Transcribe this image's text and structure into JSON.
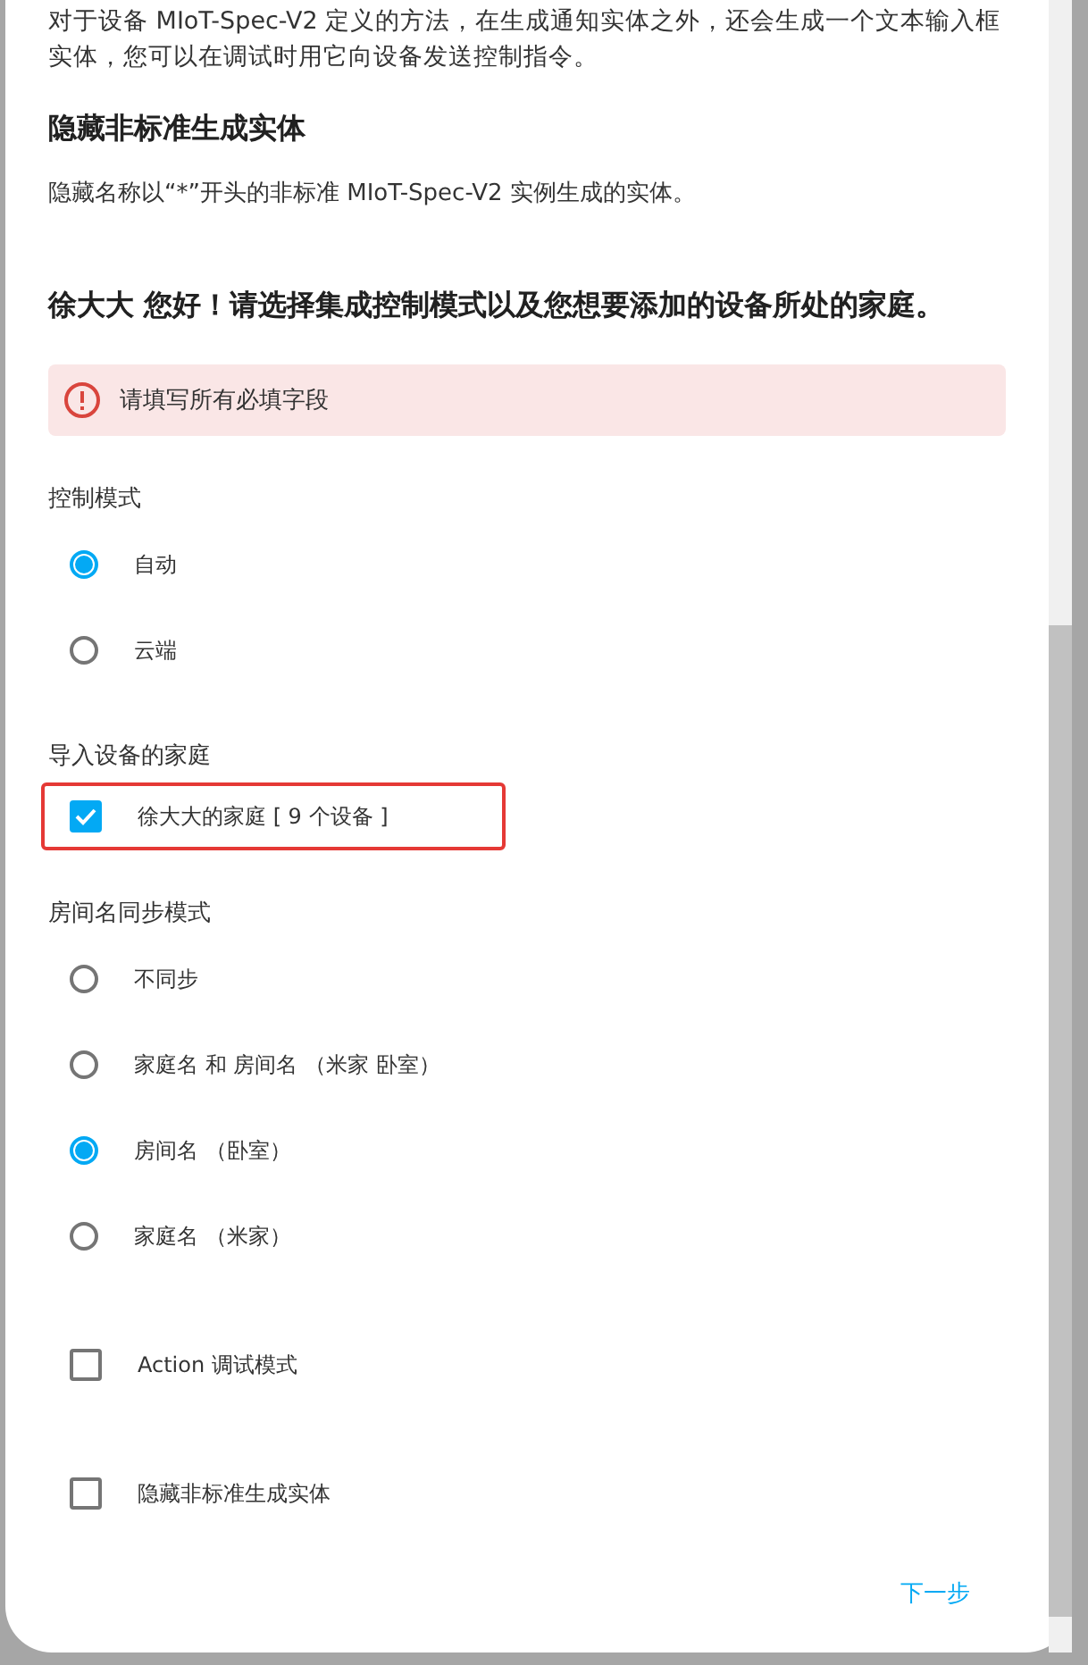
{
  "intro": {
    "text": "对于设备 MIoT-Spec-V2 定义的方法，在生成通知实体之外，还会生成一个文本输入框实体，您可以在调试时用它向设备发送控制指令。"
  },
  "hide_section": {
    "heading": "隐藏非标准生成实体",
    "description": "隐藏名称以“*”开头的非标准 MIoT-Spec-V2 实例生成的实体。"
  },
  "title": "徐大大 您好！请选择集成控制模式以及您想要添加的设备所处的家庭。",
  "alert": {
    "text": "请填写所有必填字段"
  },
  "control_mode": {
    "label": "控制模式",
    "options": [
      {
        "label": "自动",
        "selected": true
      },
      {
        "label": "云端",
        "selected": false
      }
    ]
  },
  "homes": {
    "label": "导入设备的家庭",
    "highlighted": true,
    "items": [
      {
        "label": "徐大大的家庭 [ 9 个设备 ]",
        "checked": true
      }
    ]
  },
  "room_sync": {
    "label": "房间名同步模式",
    "options": [
      {
        "label": "不同步",
        "selected": false
      },
      {
        "label": "家庭名 和 房间名 （米家 卧室）",
        "selected": false
      },
      {
        "label": "房间名 （卧室）",
        "selected": true
      },
      {
        "label": "家庭名 （米家）",
        "selected": false
      }
    ]
  },
  "toggles": [
    {
      "label": "Action 调试模式",
      "checked": false
    },
    {
      "label": "隐藏非标准生成实体",
      "checked": false
    }
  ],
  "next_button": "下一步"
}
